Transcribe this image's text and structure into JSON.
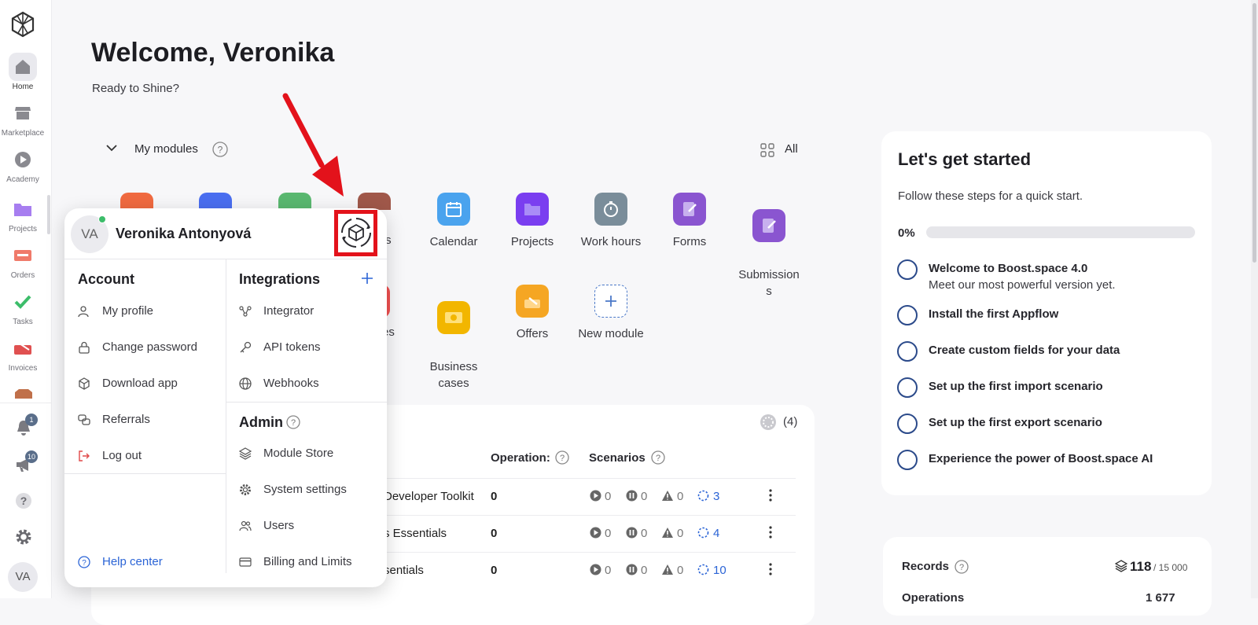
{
  "sidebar": {
    "items": [
      {
        "label": "Home",
        "icon": "home-icon"
      },
      {
        "label": "Marketplace",
        "icon": "store-icon"
      },
      {
        "label": "Academy",
        "icon": "play-icon"
      },
      {
        "label": "Projects",
        "icon": "folder-icon"
      },
      {
        "label": "Orders",
        "icon": "orders-icon"
      },
      {
        "label": "Tasks",
        "icon": "check-icon"
      },
      {
        "label": "Invoices",
        "icon": "invoice-icon"
      }
    ],
    "notifications_count": "1",
    "announcements_count": "10",
    "avatar_initials": "VA"
  },
  "header": {
    "title": "Welcome, Veronika",
    "subtitle": "Ready to Shine?"
  },
  "modules": {
    "section_title": "My modules",
    "all_label": "All",
    "row1": [
      {
        "label": "Calendar",
        "color": "#4aa3ee"
      },
      {
        "label": "Projects",
        "color": "#7a3ef0"
      },
      {
        "label": "Work hours",
        "color": "#7a8d9a"
      },
      {
        "label": "Forms",
        "color": "#8a55d0"
      },
      {
        "label": "Submission\ns",
        "color": "#8a55d0"
      }
    ],
    "row1_partial": "ts",
    "row2": [
      {
        "label": "Business\ncases",
        "color": "#f2b600"
      },
      {
        "label": "Offers",
        "color": "#f5a623"
      },
      {
        "label": "New module",
        "color": "#4a78c8"
      }
    ],
    "row2_partial": "es"
  },
  "scenarios_table": {
    "count": "(4)",
    "headers": {
      "operations": "Operation:",
      "scenarios": "Scenarios"
    },
    "rows": [
      {
        "name": "Developer Toolkit",
        "ops": "0",
        "running": "0",
        "paused": "0",
        "warnings": "0",
        "total": "3"
      },
      {
        "name": "s Essentials",
        "ops": "0",
        "running": "0",
        "paused": "0",
        "warnings": "0",
        "total": "4"
      },
      {
        "name": "sentials",
        "ops": "0",
        "running": "0",
        "paused": "0",
        "warnings": "0",
        "total": "10"
      }
    ]
  },
  "getting_started": {
    "title": "Let's get started",
    "subtitle": "Follow these steps for a quick start.",
    "progress_label": "0%",
    "progress": 0,
    "steps": [
      {
        "title": "Welcome to Boost.space 4.0",
        "desc": "Meet our most powerful version yet."
      },
      {
        "title": "Install the first Appflow"
      },
      {
        "title": "Create custom fields for your data"
      },
      {
        "title": "Set up the first import scenario"
      },
      {
        "title": "Set up the first export scenario"
      },
      {
        "title": "Experience the power of Boost.space AI"
      }
    ]
  },
  "records": {
    "label": "Records",
    "value": "118",
    "limit": "/ 15 000",
    "next_label": "Operations",
    "next_value": "1 677"
  },
  "popup": {
    "initials": "VA",
    "user_name": "Veronika Antonyová",
    "account": {
      "title": "Account",
      "items": [
        "My profile",
        "Change password",
        "Download app",
        "Referrals",
        "Log out"
      ]
    },
    "help_center": "Help center",
    "integrations": {
      "title": "Integrations",
      "items": [
        "Integrator",
        "API tokens",
        "Webhooks"
      ]
    },
    "admin": {
      "title": "Admin",
      "items": [
        "Module Store",
        "System settings",
        "Users",
        "Billing and Limits"
      ]
    }
  },
  "colors": {
    "accent": "#2b4a8a",
    "highlight": "#e3121b",
    "logout": "#e04848",
    "link": "#2b64d6"
  }
}
